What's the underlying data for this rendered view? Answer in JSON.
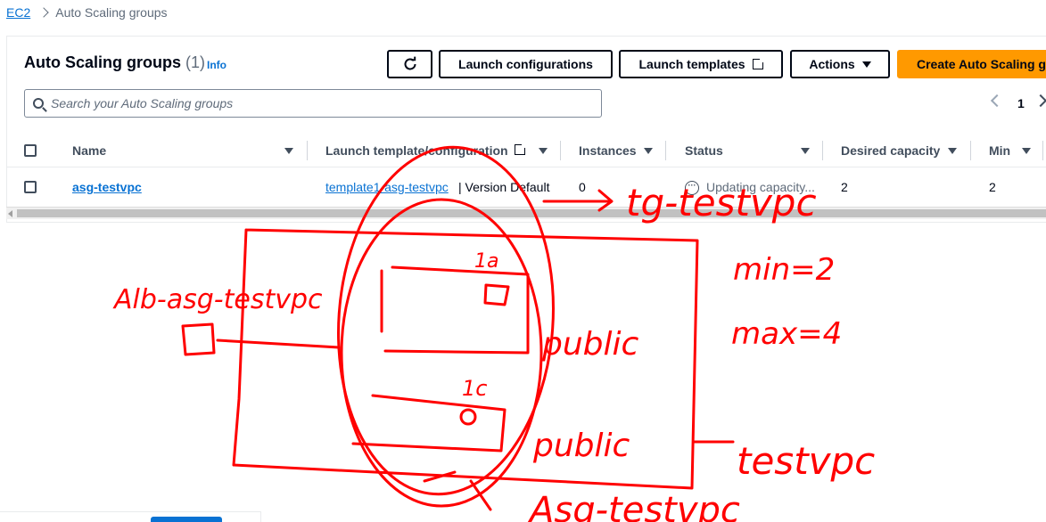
{
  "breadcrumb": {
    "root": "EC2",
    "current": "Auto Scaling groups"
  },
  "header": {
    "title": "Auto Scaling groups",
    "count": "(1)",
    "info": "Info"
  },
  "toolbar": {
    "refresh_icon": "refresh-icon",
    "launch_configurations": "Launch configurations",
    "launch_templates": "Launch templates",
    "actions": "Actions",
    "create": "Create Auto Scaling g"
  },
  "search": {
    "placeholder": "Search your Auto Scaling groups"
  },
  "pagination": {
    "page": "1"
  },
  "table": {
    "columns": [
      "Name",
      "Launch template/configuration",
      "Instances",
      "Status",
      "Desired capacity",
      "Min"
    ],
    "rows": [
      {
        "name": "asg-testvpc",
        "template_link": "template1-asg-testvpc",
        "template_suffix": "| Version Default",
        "instances": "0",
        "status": "Updating capacity...",
        "desired": "2",
        "min": "2"
      }
    ]
  },
  "annotations": {
    "alb": "Alb-asg-testvpc",
    "tg": "tg-testvpc",
    "min": "min=2",
    "max": "max=4",
    "az1": "1a",
    "az2": "1c",
    "public1": "public",
    "public2": "public",
    "vpc": "testvpc",
    "asg": "Asg-testvpc",
    "ink_color": "#ff0000"
  },
  "colors": {
    "accent": "#0972d3",
    "primary_button": "#ff9900"
  }
}
